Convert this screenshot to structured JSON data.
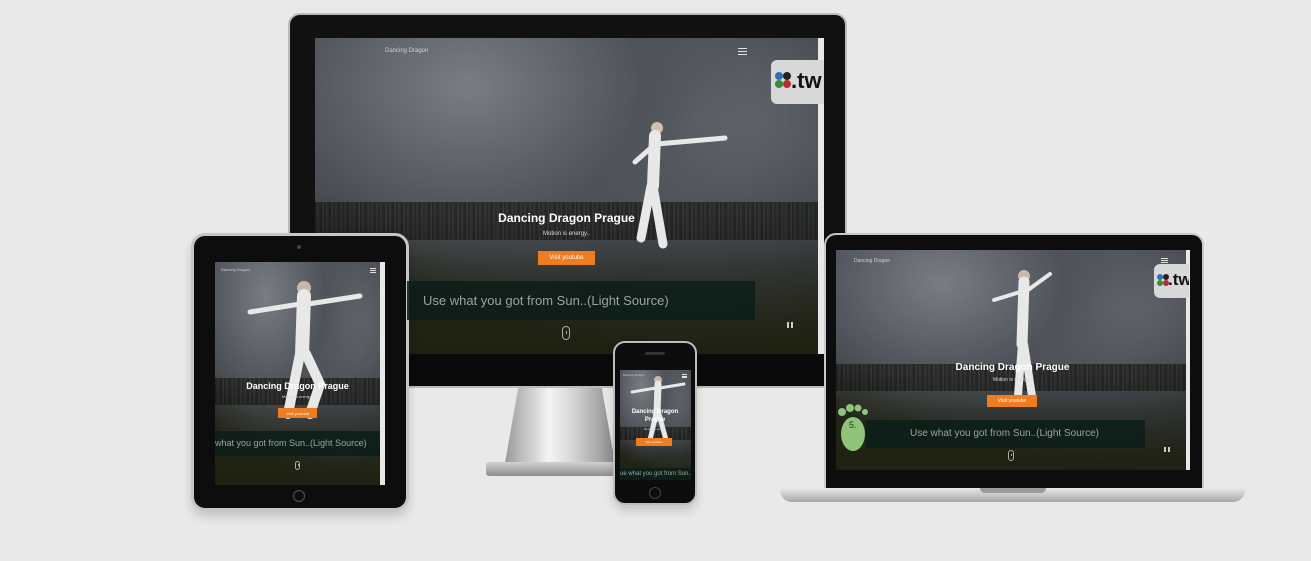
{
  "site": {
    "logo": "Dancing Dragon",
    "title": "Dancing Dragon Prague",
    "subtitle": "Motion is energy..",
    "cta": "Visit youtube",
    "ticker": "Use what you got from  Sun..(Light Source)",
    "tablet_ticker": "what you got from  Sun..(Light Source)",
    "phone_ticker": "ue what you got from  Sun..(Light",
    "badge_text": ".tw",
    "footprint_label": "5."
  },
  "colors": {
    "accent": "#f07c21",
    "background": "#e9e9e9",
    "ticker_bg": "#0c1e18"
  }
}
